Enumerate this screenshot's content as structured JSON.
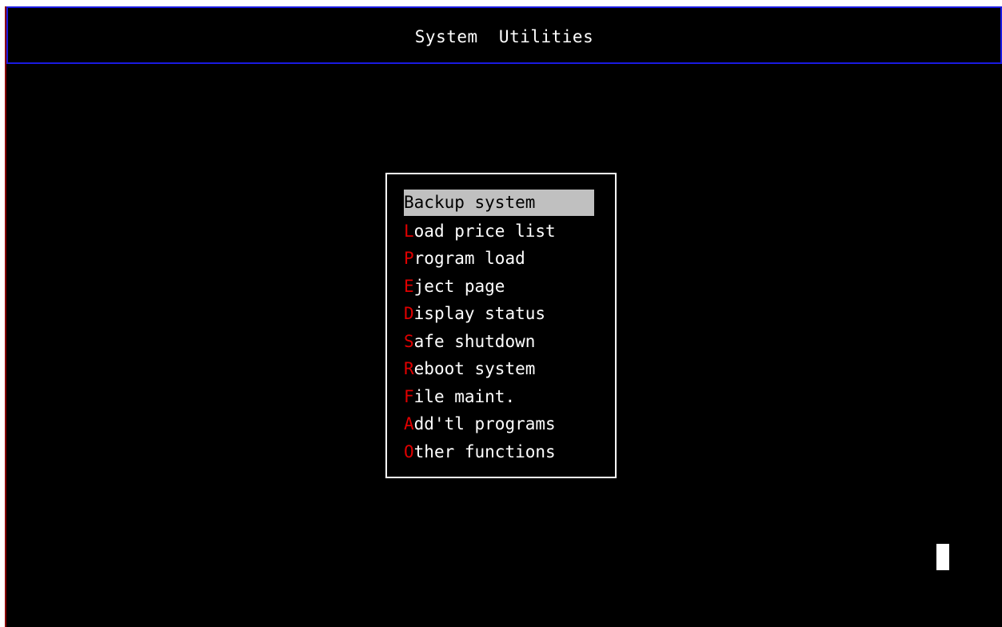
{
  "header": {
    "title": "System  Utilities"
  },
  "menu": {
    "items": [
      {
        "hotkey": "B",
        "rest": "ackup system",
        "selected": true
      },
      {
        "hotkey": "L",
        "rest": "oad price list",
        "selected": false
      },
      {
        "hotkey": "P",
        "rest": "rogram load",
        "selected": false
      },
      {
        "hotkey": "E",
        "rest": "ject page",
        "selected": false
      },
      {
        "hotkey": "D",
        "rest": "isplay status",
        "selected": false
      },
      {
        "hotkey": "S",
        "rest": "afe shutdown",
        "selected": false
      },
      {
        "hotkey": "R",
        "rest": "eboot system",
        "selected": false
      },
      {
        "hotkey": "F",
        "rest": "ile maint.",
        "selected": false
      },
      {
        "hotkey": "A",
        "rest": "dd'tl programs",
        "selected": false
      },
      {
        "hotkey": "O",
        "rest": "ther functions",
        "selected": false
      }
    ]
  },
  "colors": {
    "background": "#000000",
    "header_border": "#1a1ae0",
    "hotkey": "#e00000",
    "text": "#ffffff",
    "highlight_bg": "#c0c0c0",
    "highlight_text": "#000000"
  }
}
